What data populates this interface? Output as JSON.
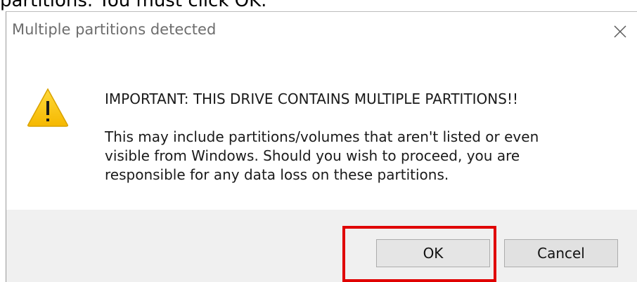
{
  "background_caption": "partitions. You must click OK.",
  "dialog": {
    "title": "Multiple partitions detected",
    "close_icon": "close-icon",
    "warning_icon": "warning-triangle-icon",
    "heading": "IMPORTANT: THIS DRIVE CONTAINS MULTIPLE PARTITIONS!!",
    "body_lines": [
      "This may include partitions/volumes that aren't listed or even",
      "visible from Windows. Should you wish to proceed, you are",
      "responsible for any data loss on these partitions."
    ],
    "buttons": {
      "ok": "OK",
      "cancel": "Cancel"
    }
  },
  "colors": {
    "highlight": "#e00000",
    "warning_fill": "#ffc20e",
    "footer_bg": "#f0f0f0"
  }
}
